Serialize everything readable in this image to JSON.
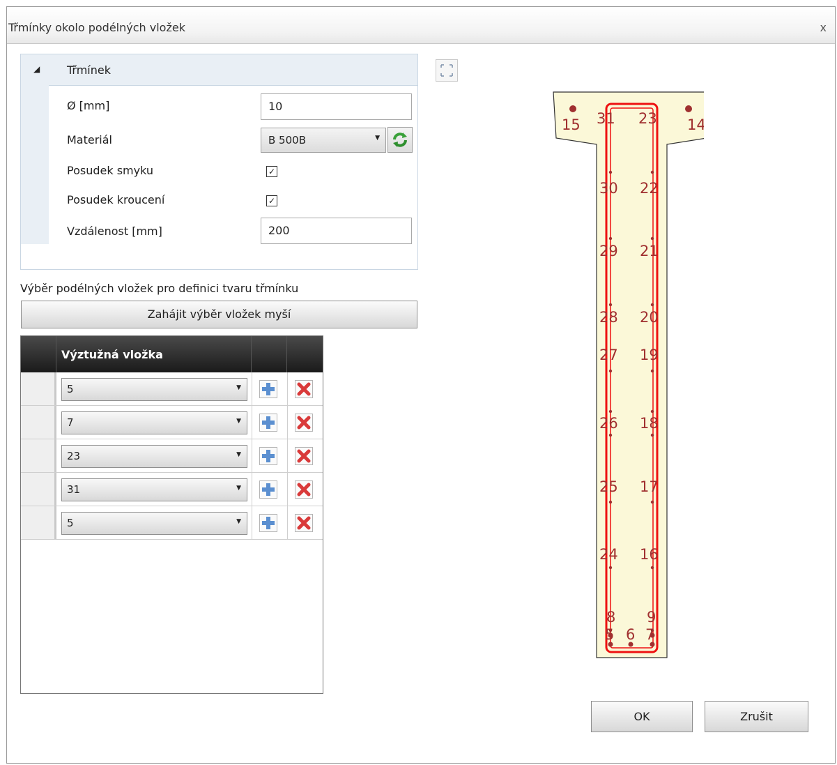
{
  "window": {
    "title": "Třmínky okolo podélných vložek",
    "close_glyph": "x"
  },
  "properties": {
    "category": "Třmínek",
    "diameter": {
      "label": "Ø [mm]",
      "value": "10"
    },
    "material": {
      "label": "Materiál",
      "value": "B 500B"
    },
    "shear_check": {
      "label": "Posudek smyku",
      "checked": true
    },
    "torsion_check": {
      "label": "Posudek kroucení",
      "checked": true
    },
    "spacing": {
      "label": "Vzdálenost [mm]",
      "value": "200"
    }
  },
  "selection": {
    "label": "Výběr podélných vložek pro definici tvaru třmínku",
    "button": "Zahájit výběr vložek myší"
  },
  "grid": {
    "header": "Výztužná vložka",
    "rows": [
      {
        "value": "5"
      },
      {
        "value": "7"
      },
      {
        "value": "23"
      },
      {
        "value": "31"
      },
      {
        "value": "5"
      }
    ]
  },
  "section": {
    "bar_labels": [
      "15",
      "31",
      "23",
      "14",
      "30",
      "22",
      "29",
      "21",
      "28",
      "20",
      "27",
      "19",
      "26",
      "18",
      "25",
      "17",
      "24",
      "16",
      "8",
      "9",
      "5",
      "6",
      "7"
    ],
    "colors": {
      "fill": "#fbf8d8",
      "stirrup": "#ee1111",
      "bar": "#a03030"
    }
  },
  "buttons": {
    "ok": "OK",
    "cancel": "Zrušit"
  }
}
